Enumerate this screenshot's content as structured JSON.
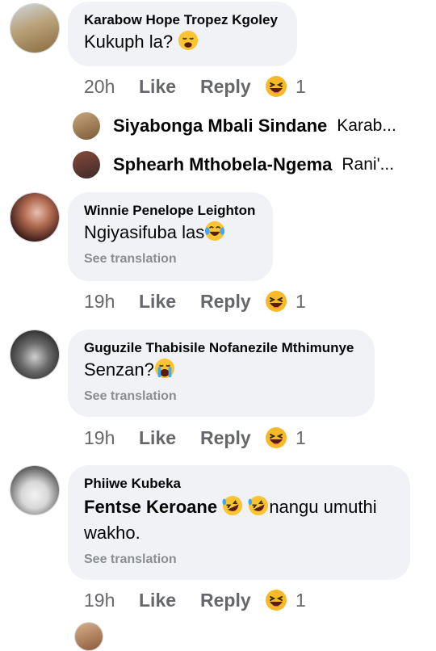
{
  "comments": [
    {
      "author": "Karabow Hope Tropez  Kgoley",
      "text": "Kukuph la?",
      "emoji": "weary-face",
      "time": "20h",
      "like": "Like",
      "reply": "Reply",
      "reaction": "haha",
      "reaction_count": "1"
    },
    {
      "author": "Winnie Penelope Leighton",
      "text": "Ngiyasifuba las",
      "emoji": "crying-laughing-face",
      "translate": "See translation",
      "time": "19h",
      "like": "Like",
      "reply": "Reply",
      "reaction": "haha",
      "reaction_count": "1"
    },
    {
      "author": "Guguzile Thabisile Nofanezile Mthimunye",
      "text": "Senzan?",
      "emoji": "crying-face",
      "translate": "See translation",
      "time": "19h",
      "like": "Like",
      "reply": "Reply",
      "reaction": "haha",
      "reaction_count": "1"
    },
    {
      "author": "Phiiwe Kubeka",
      "mention": "Fentse Keroane",
      "text_after": "nangu umuthi",
      "text_line2": "wakho.",
      "emoji": "rolling-laughing-face",
      "translate": "See translation",
      "time": "19h",
      "like": "Like",
      "reply": "Reply",
      "reaction": "haha",
      "reaction_count": "1"
    }
  ],
  "replies": [
    {
      "name": "Siyabonga Mbali Sindane",
      "snippet": "Karab..."
    },
    {
      "name": "Sphearh Mthobela-Ngema",
      "snippet": "Rani'..."
    }
  ],
  "colors": {
    "bubble": "#f0f2f5",
    "meta": "#65676b",
    "translate": "#8a8d91",
    "haha": "#f7b928"
  }
}
